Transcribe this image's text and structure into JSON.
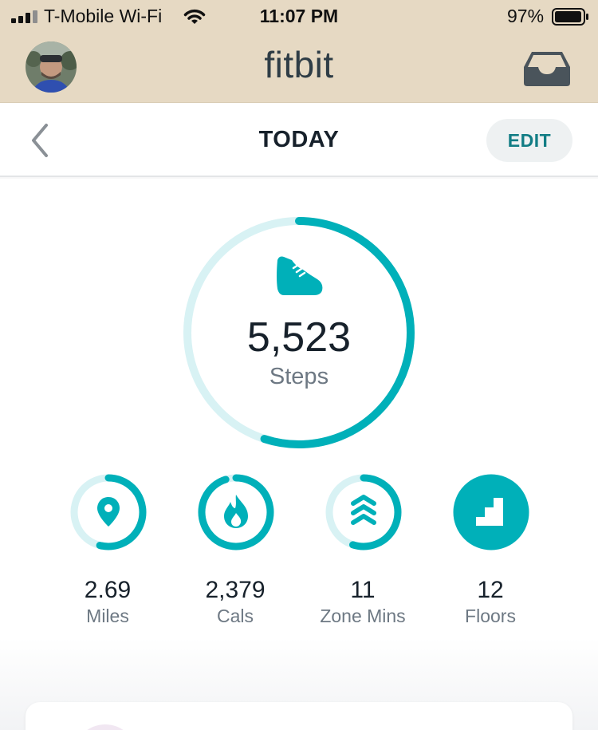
{
  "status_bar": {
    "carrier": "T-Mobile Wi-Fi",
    "time": "11:07 PM",
    "battery_pct": "97%",
    "battery_level": 0.97
  },
  "header": {
    "brand": "fitbit",
    "avatar_icon": "profile-photo",
    "inbox_icon": "inbox-tray-icon"
  },
  "subheader": {
    "back_icon": "chevron-left-icon",
    "title": "TODAY",
    "edit_label": "EDIT"
  },
  "steps": {
    "value": "5,523",
    "label": "Steps",
    "icon": "shoe-icon",
    "progress": 0.55
  },
  "stats": [
    {
      "id": "miles",
      "value": "2.69",
      "label": "Miles",
      "icon": "map-pin-icon",
      "progress": 0.54
    },
    {
      "id": "cals",
      "value": "2,379",
      "label": "Cals",
      "icon": "flame-icon",
      "progress": 0.95
    },
    {
      "id": "zone-mins",
      "value": "11",
      "label": "Zone Mins",
      "icon": "chevrons-up-icon",
      "progress": 0.55
    },
    {
      "id": "floors",
      "value": "12",
      "label": "Floors",
      "icon": "stairs-icon",
      "progress": 1.0
    }
  ],
  "colors": {
    "accent": "#00b0b9",
    "track": "#d8f2f4",
    "header_bg": "#e6d9c3",
    "edit_text": "#127d85"
  }
}
